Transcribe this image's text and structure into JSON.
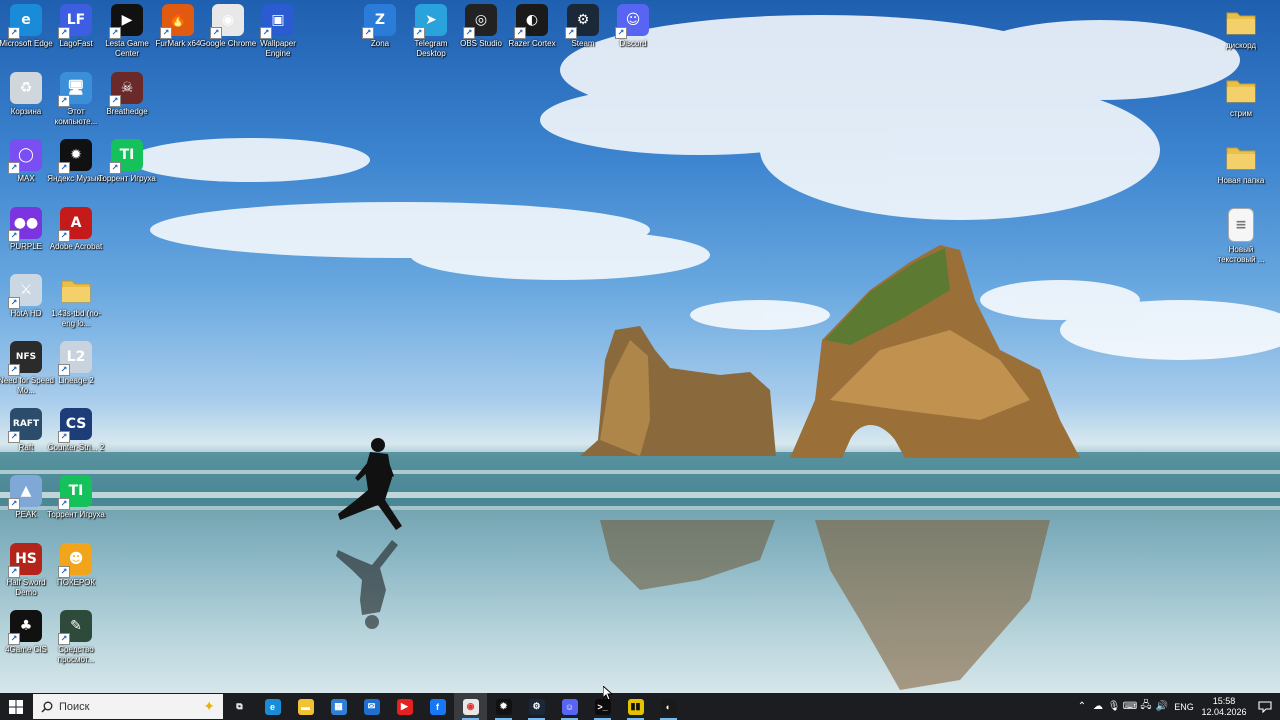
{
  "desktop_icons": [
    {
      "label": "Microsoft Edge",
      "icon": "edge-icon",
      "color": "#1a8bd6",
      "glyph": "e",
      "shortcut": true
    },
    {
      "label": "LagoFast",
      "icon": "lagofast-icon",
      "color": "#3d5ee0",
      "glyph": "LF",
      "shortcut": true
    },
    {
      "label": "Lesta Game Center",
      "icon": "lesta-icon",
      "color": "#111111",
      "glyph": "▶",
      "shortcut": true
    },
    {
      "label": "FurMark x64",
      "icon": "furmark-icon",
      "color": "#e05a10",
      "glyph": "🔥",
      "shortcut": true
    },
    {
      "label": "Google Chrome",
      "icon": "chrome-icon",
      "color": "#e8e8e8",
      "glyph": "◉",
      "shortcut": true
    },
    {
      "label": "Wallpaper Engine",
      "icon": "wallpaper-engine-icon",
      "color": "#2a5bd0",
      "glyph": "▣",
      "shortcut": true
    },
    {
      "label": "Zona",
      "icon": "zona-icon",
      "color": "#2b7bd9",
      "glyph": "Z",
      "shortcut": true
    },
    {
      "label": "Telegram Desktop",
      "icon": "telegram-icon",
      "color": "#2aa3dd",
      "glyph": "➤",
      "shortcut": true
    },
    {
      "label": "OBS Studio",
      "icon": "obs-icon",
      "color": "#222222",
      "glyph": "◎",
      "shortcut": true
    },
    {
      "label": "Razer Cortex",
      "icon": "razer-cortex-icon",
      "color": "#1a1a1a",
      "glyph": "◐",
      "shortcut": true
    },
    {
      "label": "Steam",
      "icon": "steam-icon",
      "color": "#1b2838",
      "glyph": "⚙",
      "shortcut": true
    },
    {
      "label": "Discord",
      "icon": "discord-icon",
      "color": "#5865f2",
      "glyph": "☺",
      "shortcut": true
    },
    {
      "label": "Корзина",
      "icon": "recycle-bin-icon",
      "color": "#cfd6dc",
      "glyph": "♻",
      "shortcut": false
    },
    {
      "label": "Этот компьюте...",
      "icon": "this-pc-icon",
      "color": "#3a8fd8",
      "glyph": "🖥",
      "shortcut": true
    },
    {
      "label": "Breathedge",
      "icon": "breathedge-icon",
      "color": "#6b2a2a",
      "glyph": "☠",
      "shortcut": true
    },
    {
      "label": "MAX",
      "icon": "max-icon",
      "color": "#7a4ef0",
      "glyph": "◯",
      "shortcut": true
    },
    {
      "label": "Яндекс Музыка",
      "icon": "yandex-music-icon",
      "color": "#111111",
      "glyph": "✹",
      "shortcut": true
    },
    {
      "label": "Торрент Игруха",
      "icon": "torrent-igruha-icon",
      "color": "#15c15b",
      "glyph": "TI",
      "shortcut": true
    },
    {
      "label": "PURPLE",
      "icon": "purple-icon",
      "color": "#7b35e0",
      "glyph": "●●",
      "shortcut": true
    },
    {
      "label": "Adobe Acrobat",
      "icon": "acrobat-icon",
      "color": "#c41a1a",
      "glyph": "A",
      "shortcut": true
    },
    {
      "label": "HotA HD",
      "icon": "hota-icon",
      "color": "#cbd7e3",
      "glyph": "⚔",
      "shortcut": true
    },
    {
      "label": "1.43s-tbd (no-eng lo...",
      "icon": "folder-icon",
      "color": "#e9c04a",
      "glyph": "",
      "shortcut": false
    },
    {
      "label": "Need for Speed Mo...",
      "icon": "nfs-icon",
      "color": "#2b2b2b",
      "glyph": "NFS",
      "shortcut": true
    },
    {
      "label": "Lineage 2",
      "icon": "lineage2-icon",
      "color": "#c9d3de",
      "glyph": "L2",
      "shortcut": true
    },
    {
      "label": "Raft",
      "icon": "raft-icon",
      "color": "#2c4c6b",
      "glyph": "RAFT",
      "shortcut": true
    },
    {
      "label": "Counter-Stri... 2",
      "icon": "cs2-icon",
      "color": "#1d3d78",
      "glyph": "CS",
      "shortcut": true
    },
    {
      "label": "PEAK",
      "icon": "peak-icon",
      "color": "#7fa8d6",
      "glyph": "▲",
      "shortcut": true
    },
    {
      "label": "Торрент Игруха",
      "icon": "torrent-igruha-icon",
      "color": "#15c15b",
      "glyph": "TI",
      "shortcut": true
    },
    {
      "label": "Half Sword Demo",
      "icon": "half-sword-icon",
      "color": "#b3241b",
      "glyph": "HS",
      "shortcut": true
    },
    {
      "label": "ПОКЕРОК",
      "icon": "pokerok-icon",
      "color": "#f2a51a",
      "glyph": "☻",
      "shortcut": true
    },
    {
      "label": "4Game CIS",
      "icon": "4game-icon",
      "color": "#111111",
      "glyph": "♣",
      "shortcut": true
    },
    {
      "label": "Средство просмот...",
      "icon": "viewer-icon",
      "color": "#2e4a3a",
      "glyph": "✎",
      "shortcut": true
    },
    {
      "label": "дискорд",
      "icon": "folder-icon",
      "color": "#e9c04a",
      "glyph": "",
      "shortcut": false
    },
    {
      "label": "стрим",
      "icon": "folder-icon",
      "color": "#e9c04a",
      "glyph": "",
      "shortcut": false
    },
    {
      "label": "Новая папка",
      "icon": "folder-icon",
      "color": "#e9c04a",
      "glyph": "",
      "shortcut": false
    },
    {
      "label": "Новый текстовый ...",
      "icon": "text-document-icon",
      "color": "#f6f6f6",
      "glyph": "≡",
      "shortcut": false
    }
  ],
  "taskbar": {
    "search_placeholder": "Поиск",
    "apps": [
      {
        "name": "task-view-icon",
        "glyph": "⧉",
        "color": "transparent",
        "active": false
      },
      {
        "name": "edge-icon",
        "glyph": "e",
        "color": "#1a8bd6",
        "active": false
      },
      {
        "name": "file-explorer-icon",
        "glyph": "▬",
        "color": "#f1c232",
        "active": false
      },
      {
        "name": "microsoft-store-icon",
        "glyph": "▦",
        "color": "#2f7fd6",
        "active": false
      },
      {
        "name": "outlook-icon",
        "glyph": "✉",
        "color": "#1e6fd0",
        "active": false
      },
      {
        "name": "youtube-icon",
        "glyph": "▶",
        "color": "#e52020",
        "active": false
      },
      {
        "name": "facebook-icon",
        "glyph": "f",
        "color": "#1877f2",
        "active": false
      },
      {
        "name": "chrome-icon",
        "glyph": "◉",
        "color": "#e8e8e8",
        "active": true
      },
      {
        "name": "yandex-music-icon",
        "glyph": "✹",
        "color": "#111111",
        "active": true
      },
      {
        "name": "steam-icon",
        "glyph": "⚙",
        "color": "#1b2838",
        "active": true
      },
      {
        "name": "discord-icon",
        "glyph": "☺",
        "color": "#5865f2",
        "active": true
      },
      {
        "name": "terminal-icon",
        "glyph": ">_",
        "color": "#0c0c0c",
        "active": true
      },
      {
        "name": "game-launcher-icon",
        "glyph": "▮▮",
        "color": "#e5c300",
        "active": true
      },
      {
        "name": "razer-cortex-icon",
        "glyph": "◐",
        "color": "#1a1a1a",
        "active": true
      }
    ],
    "tray": {
      "language": "ENG",
      "time": "15:58",
      "date": "12.04.2026",
      "icons": [
        "chevron-up-icon",
        "onedrive-icon",
        "microphone-icon",
        "keyboard-icon",
        "network-icon",
        "volume-icon"
      ]
    }
  }
}
